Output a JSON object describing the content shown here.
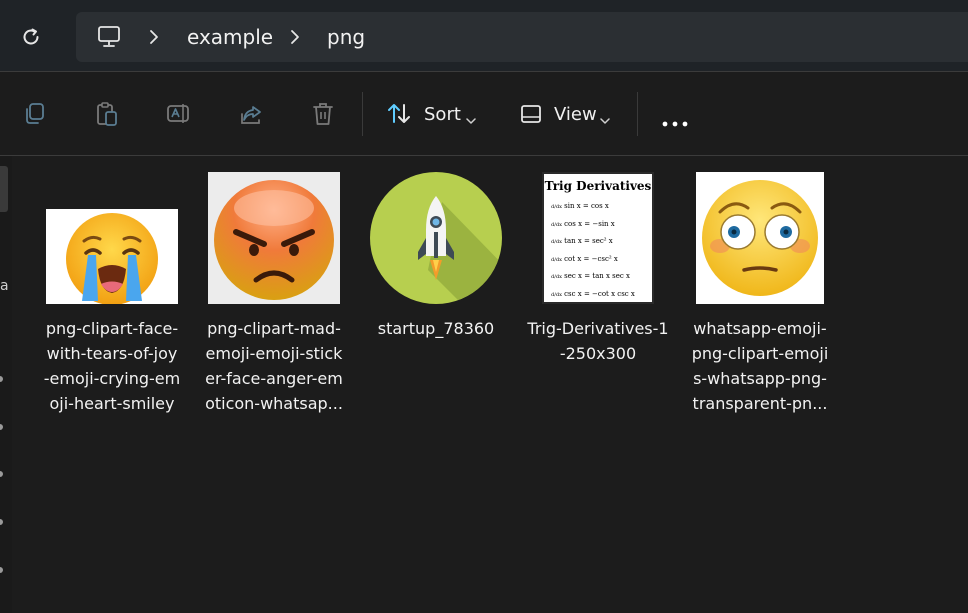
{
  "breadcrumb": {
    "items": [
      "example",
      "png"
    ]
  },
  "toolbar": {
    "sort_label": "Sort",
    "view_label": "View"
  },
  "nav": {
    "letter": "a"
  },
  "files": [
    {
      "name": "png-clipart-face-\nwith-tears-of-joy\n-emoji-crying-em\noji-heart-smiley"
    },
    {
      "name": "png-clipart-mad-\nemoji-emoji-stick\ner-face-anger-em\noticon-whatsap..."
    },
    {
      "name": "startup_78360"
    },
    {
      "name": "Trig-Derivatives-1\n-250x300"
    },
    {
      "name": "whatsapp-emoji-\npng-clipart-emoji\ns-whatsapp-png-\ntransparent-pn..."
    }
  ],
  "trig": {
    "title": "Trig Derivatives",
    "rows": [
      "sin x = cos x",
      "cos x = −sin x",
      "tan x = sec² x",
      "cot x = −csc² x",
      "sec x = tan x sec x",
      "csc x = −cot x csc x"
    ],
    "prefix": "d/dx"
  },
  "colors": {
    "accent_icon": "#60cdff",
    "background": "#1c1c1c"
  },
  "icons": {
    "refresh": "refresh-icon",
    "pc": "this-pc-icon",
    "copy": "copy-icon",
    "paste": "paste-icon",
    "rename": "rename-icon",
    "share": "share-icon",
    "delete": "delete-icon",
    "sort": "sort-icon",
    "view": "view-icon",
    "more": "more-options-icon"
  }
}
